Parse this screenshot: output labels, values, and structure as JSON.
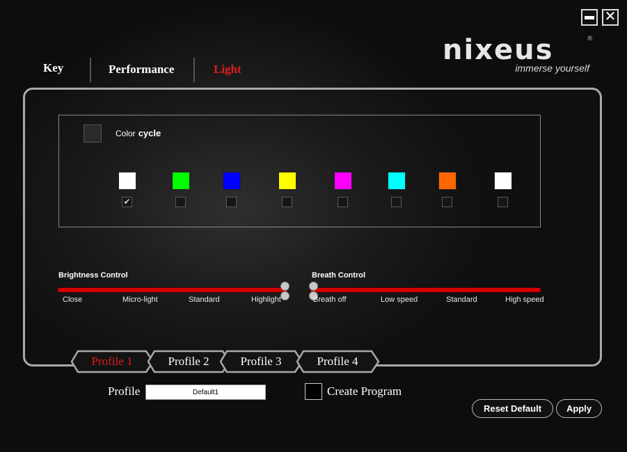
{
  "window": {
    "minimize_icon": "minimize-icon",
    "close_glyph": "✕"
  },
  "brand": {
    "name": "nixeus",
    "tagline": "immerse yourself",
    "registered": "®"
  },
  "tabs": [
    {
      "label": "Key",
      "active": false
    },
    {
      "label": "Performance",
      "active": false
    },
    {
      "label": "Light",
      "active": true
    }
  ],
  "color_cycle": {
    "label_part1": "Color",
    "label_part2": "cycle",
    "checked": false
  },
  "colors": [
    {
      "name": "white",
      "hex": "#ffffff",
      "checked": true
    },
    {
      "name": "green",
      "hex": "#00ff00",
      "checked": false
    },
    {
      "name": "blue",
      "hex": "#0000ff",
      "checked": false
    },
    {
      "name": "yellow",
      "hex": "#ffff00",
      "checked": false
    },
    {
      "name": "magenta",
      "hex": "#ff00ff",
      "checked": false
    },
    {
      "name": "cyan",
      "hex": "#00ffff",
      "checked": false
    },
    {
      "name": "orange",
      "hex": "#ff6600",
      "checked": false
    },
    {
      "name": "white-2",
      "hex": "#ffffff",
      "checked": false
    }
  ],
  "brightness": {
    "title": "Brightness Control",
    "ticks": [
      "Close",
      "Micro-light",
      "Standard",
      "Highlight"
    ],
    "selected": "Highlight"
  },
  "breath": {
    "title": "Breath Control",
    "ticks": [
      "Breath off",
      "Low speed",
      "Standard",
      "High speed"
    ],
    "selected": "Breath off"
  },
  "profiles": [
    {
      "label": "Profile 1",
      "active": true
    },
    {
      "label": "Profile 2",
      "active": false
    },
    {
      "label": "Profile 3",
      "active": false
    },
    {
      "label": "Profile 4",
      "active": false
    }
  ],
  "profile": {
    "label": "Profile",
    "value": "Default1"
  },
  "create_program": {
    "label": "Create Program",
    "checked": false
  },
  "buttons": {
    "reset": "Reset Default",
    "apply": "Apply"
  },
  "accent_color": "#e31b1b"
}
